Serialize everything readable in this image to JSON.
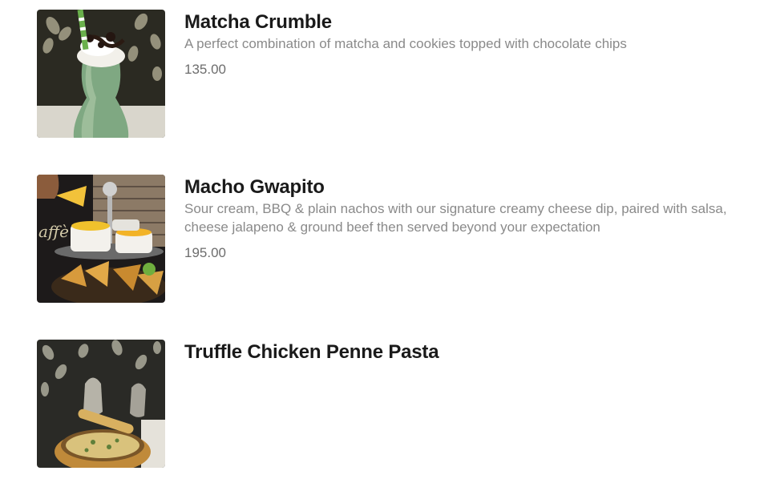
{
  "menu": {
    "items": [
      {
        "title": "Matcha Crumble",
        "description": "A perfect combination of matcha and cookies topped with chocolate chips",
        "price": "135.00",
        "image": "matcha-crumble-photo"
      },
      {
        "title": "Macho Gwapito",
        "description": "Sour cream, BBQ & plain nachos with our signature creamy cheese dip, paired with salsa, cheese jalapeno & ground beef then served beyond your expectation",
        "price": "195.00",
        "image": "macho-gwapito-photo"
      },
      {
        "title": "Truffle Chicken Penne Pasta",
        "description": "",
        "price": "",
        "image": "truffle-chicken-penne-pasta-photo"
      }
    ]
  },
  "colors": {
    "title": "#1a1a1a",
    "description": "#8a8a8a",
    "price": "#6d6d6d",
    "background": "#ffffff"
  }
}
